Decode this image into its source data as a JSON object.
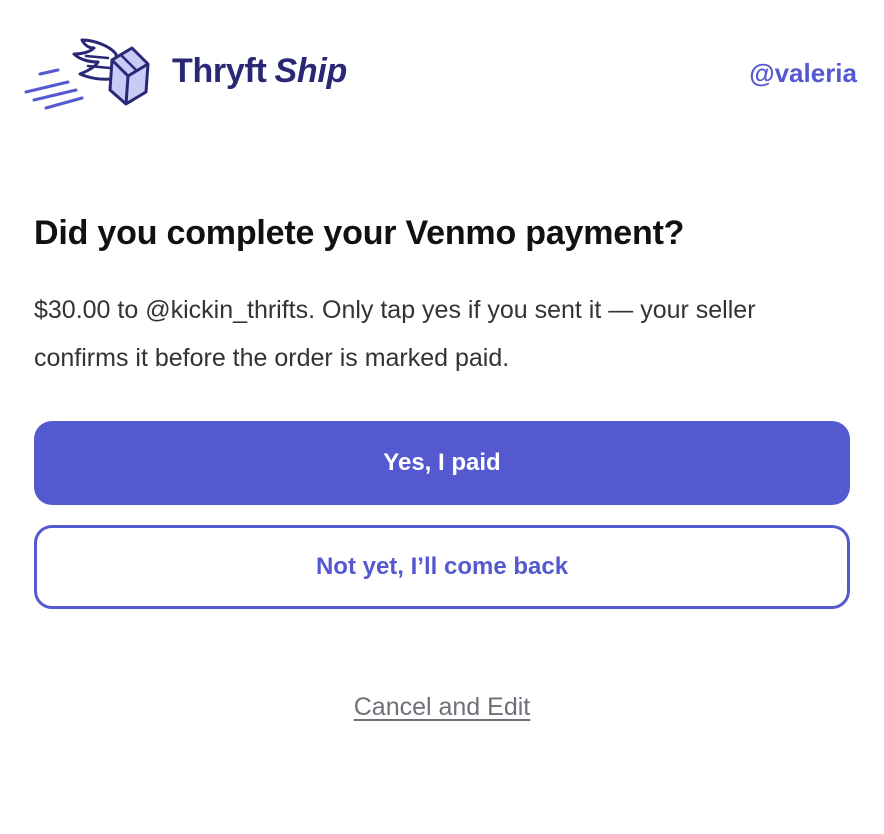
{
  "header": {
    "logo_icon": "winged-box-icon",
    "brand_part1": "Thryft",
    "brand_part2": "Ship",
    "username": "@valeria"
  },
  "prompt": {
    "title": "Did you complete your Venmo payment?",
    "description": "$30.00 to @kickin_thrifts. Only tap yes if you sent it — your seller confirms it before the order is marked paid."
  },
  "actions": {
    "confirm_label": "Yes, I paid",
    "later_label": "Not yet, I’ll come back",
    "cancel_label": "Cancel and Edit"
  },
  "colors": {
    "accent": "#5559d0",
    "brand_text": "#2a2775",
    "logo_fill": "#c9caf5",
    "link_gray": "#6e7079"
  }
}
